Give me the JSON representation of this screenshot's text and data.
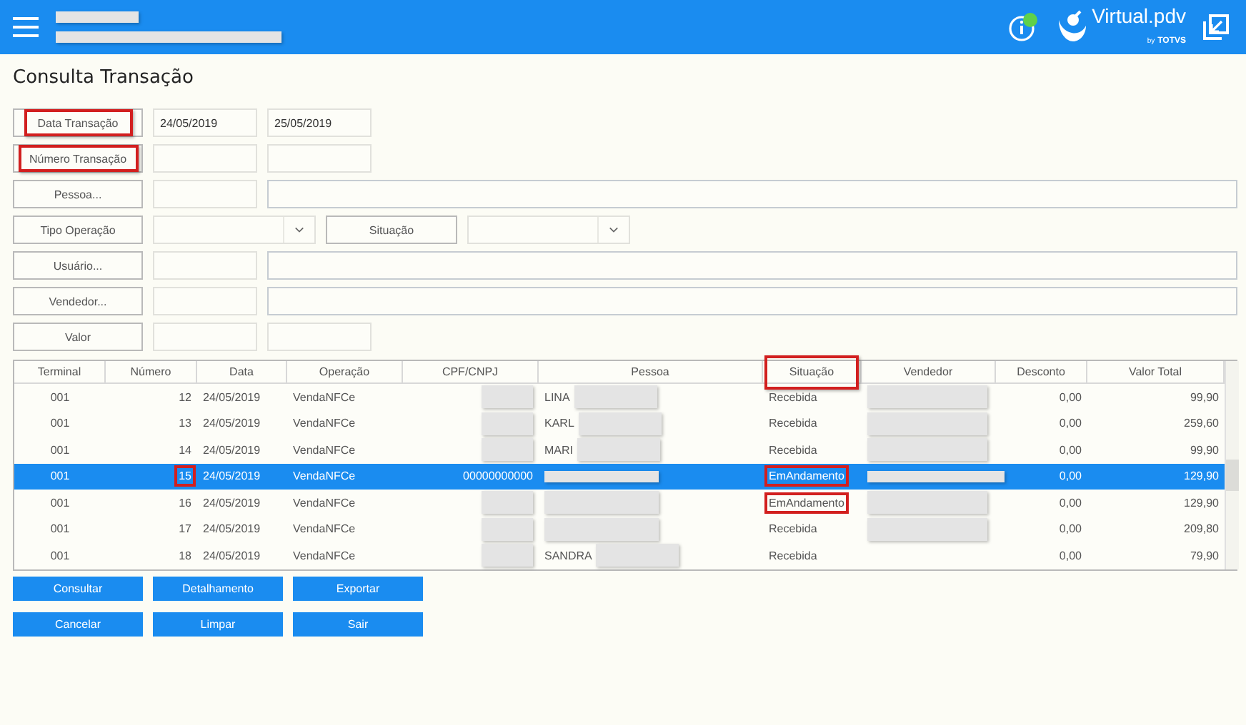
{
  "header": {
    "title_redacted": true,
    "subtitle_redacted": true,
    "info_badge": true,
    "logo": {
      "name": "Virtual.pdv",
      "by": "by",
      "brand": "TOTVS"
    }
  },
  "page_title": "Consulta Transação",
  "filters": [
    {
      "kind": "range",
      "label": "Data Transação",
      "highlighted": true,
      "from": "24/05/2019",
      "to": "25/05/2019"
    },
    {
      "kind": "range",
      "label": "Número Transação",
      "highlighted": true
    },
    {
      "kind": "lookup",
      "label": "Pessoa...",
      "highlighted": false
    },
    {
      "kind": "selects",
      "label": "Tipo Operação",
      "highlighted": false,
      "second_label": "Situação"
    },
    {
      "kind": "lookup",
      "label": "Usuário...",
      "highlighted": false
    },
    {
      "kind": "lookup",
      "label": "Vendedor...",
      "highlighted": false
    },
    {
      "kind": "range",
      "label": "Valor",
      "highlighted": false
    }
  ],
  "table": {
    "columns": [
      {
        "label": "Terminal",
        "highlighted": false
      },
      {
        "label": "Número",
        "highlighted": false
      },
      {
        "label": "Data",
        "highlighted": false
      },
      {
        "label": "Operação",
        "highlighted": false
      },
      {
        "label": "CPF/CNPJ",
        "highlighted": false
      },
      {
        "label": "Pessoa",
        "highlighted": false
      },
      {
        "label": "Situação",
        "highlighted": true
      },
      {
        "label": "Vendedor",
        "highlighted": false
      },
      {
        "label": "Desconto",
        "highlighted": false
      },
      {
        "label": "Valor Total",
        "highlighted": false
      }
    ],
    "rows": [
      {
        "selected": false,
        "terminal": "001",
        "numero": "12",
        "numero_highlighted": false,
        "data": "24/05/2019",
        "operacao": "VendaNFCe",
        "cpf_redacted": true,
        "pessoa": "LINA",
        "pessoa_redacted": true,
        "situacao": "Recebida",
        "situacao_highlighted": false,
        "vendedor_redacted": true,
        "desconto": "0,00",
        "valor_total": "99,90"
      },
      {
        "selected": false,
        "terminal": "001",
        "numero": "13",
        "numero_highlighted": false,
        "data": "24/05/2019",
        "operacao": "VendaNFCe",
        "cpf_redacted": true,
        "pessoa": "KARL",
        "pessoa_redacted": true,
        "situacao": "Recebida",
        "situacao_highlighted": false,
        "vendedor_redacted": true,
        "desconto": "0,00",
        "valor_total": "259,60"
      },
      {
        "selected": false,
        "terminal": "001",
        "numero": "14",
        "numero_highlighted": false,
        "data": "24/05/2019",
        "operacao": "VendaNFCe",
        "cpf_redacted": true,
        "pessoa": "MARI",
        "pessoa_redacted": true,
        "situacao": "Recebida",
        "situacao_highlighted": false,
        "vendedor_redacted": true,
        "desconto": "0,00",
        "valor_total": "99,90"
      },
      {
        "selected": true,
        "terminal": "001",
        "numero": "15",
        "numero_highlighted": true,
        "data": "24/05/2019",
        "operacao": "VendaNFCe",
        "cpf": "00000000000",
        "cpf_redacted": false,
        "pessoa_redacted": true,
        "situacao": "EmAndamento",
        "situacao_highlighted": true,
        "vendedor_redacted": true,
        "desconto": "0,00",
        "valor_total": "129,90"
      },
      {
        "selected": false,
        "terminal": "001",
        "numero": "16",
        "numero_highlighted": false,
        "data": "24/05/2019",
        "operacao": "VendaNFCe",
        "cpf_redacted": true,
        "pessoa_redacted": true,
        "situacao": "EmAndamento",
        "situacao_highlighted": true,
        "vendedor_redacted": true,
        "desconto": "0,00",
        "valor_total": "129,90"
      },
      {
        "selected": false,
        "terminal": "001",
        "numero": "17",
        "numero_highlighted": false,
        "data": "24/05/2019",
        "operacao": "VendaNFCe",
        "cpf_redacted": true,
        "pessoa_redacted": true,
        "situacao": "Recebida",
        "situacao_highlighted": false,
        "vendedor_redacted": true,
        "desconto": "0,00",
        "valor_total": "209,80"
      },
      {
        "selected": false,
        "terminal": "001",
        "numero": "18",
        "numero_highlighted": false,
        "data": "24/05/2019",
        "operacao": "VendaNFCe",
        "cpf_redacted": true,
        "pessoa": "SANDRA",
        "pessoa_redacted": true,
        "situacao": "Recebida",
        "situacao_highlighted": false,
        "vendedor_redacted": false,
        "desconto": "0,00",
        "valor_total": "79,90"
      }
    ]
  },
  "buttons": [
    [
      "Consultar",
      "Detalhamento",
      "Exportar"
    ],
    [
      "Cancelar",
      "Limpar",
      "Sair"
    ]
  ]
}
